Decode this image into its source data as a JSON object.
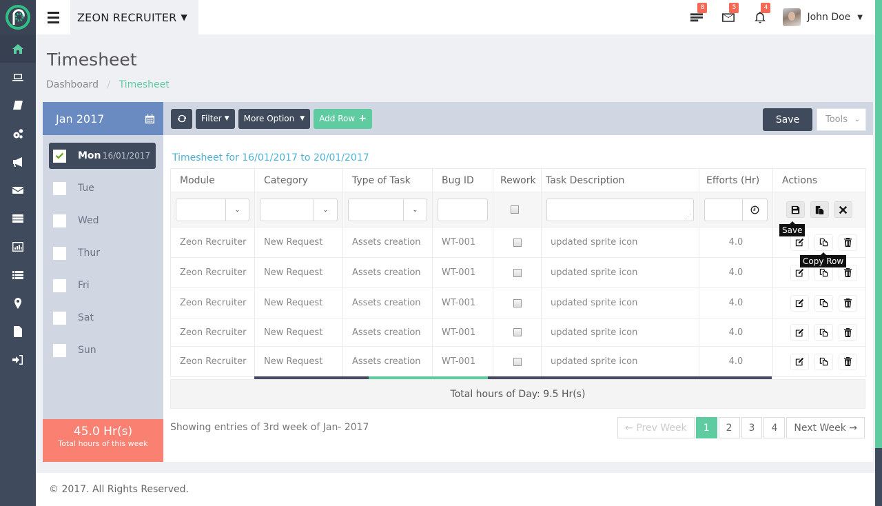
{
  "app": {
    "brand": "ZEON RECRUITER",
    "brand_caret": "▼"
  },
  "sidebar": {
    "items": [
      {
        "icon": "home-icon",
        "active": true
      },
      {
        "icon": "laptop-icon"
      },
      {
        "icon": "book-icon"
      },
      {
        "icon": "gears-icon"
      },
      {
        "icon": "megaphone-icon"
      },
      {
        "icon": "envelope-icon"
      },
      {
        "icon": "server-icon"
      },
      {
        "icon": "bar-chart-icon"
      },
      {
        "icon": "list-icon"
      },
      {
        "icon": "map-marker-icon"
      },
      {
        "icon": "file-icon"
      },
      {
        "icon": "sign-in-icon"
      }
    ]
  },
  "header": {
    "notifications": [
      {
        "icon": "tasks-icon",
        "count": "8"
      },
      {
        "icon": "envelope-icon",
        "count": "5"
      },
      {
        "icon": "bell-icon",
        "count": "4"
      }
    ],
    "user_name": "John Doe",
    "user_caret": "▾"
  },
  "page": {
    "title": "Timesheet",
    "breadcrumb": [
      {
        "label": "Dashboard"
      },
      {
        "label": "Timesheet",
        "current": true
      }
    ],
    "breadcrumb_sep": "/"
  },
  "days_panel": {
    "month": "Jan 2017",
    "days": [
      {
        "name": "Mon",
        "date": "16/01/2017",
        "checked": true,
        "active": true
      },
      {
        "name": "Tue",
        "checked": false
      },
      {
        "name": "Wed",
        "checked": false
      },
      {
        "name": "Thur",
        "checked": false
      },
      {
        "name": "Fri",
        "checked": false
      },
      {
        "name": "Sat",
        "checked": false
      },
      {
        "name": "Sun",
        "checked": false
      }
    ],
    "week_total_value": "45.0 Hr(s)",
    "week_total_label": "Total hours of this week"
  },
  "toolbar": {
    "filter_label": "Filter",
    "more_option_label": "More Option",
    "add_row_label": "Add Row",
    "add_row_icon": "+",
    "save_label": "Save",
    "tools_label": "Tools",
    "caret": "▾",
    "chev": "⌄"
  },
  "timesheet": {
    "range_label": "Timesheet for 16/01/2017 to 20/01/2017",
    "columns": [
      "Module",
      "Category",
      "Type of Task",
      "Bug ID",
      "Rework",
      "Task Description",
      "Efforts (Hr)",
      "Actions"
    ],
    "entry_row": {
      "module": "",
      "category": "",
      "type_of_task": "",
      "bug_id": "",
      "rework": false,
      "task_description": "",
      "efforts": ""
    },
    "rows": [
      {
        "module": "Zeon Recruiter",
        "category": "New Request",
        "type_of_task": "Assets creation",
        "bug_id": "WT-001",
        "rework": false,
        "task_description": "updated sprite icon",
        "efforts": "4.0"
      },
      {
        "module": "Zeon Recruiter",
        "category": "New Request",
        "type_of_task": "Assets creation",
        "bug_id": "WT-001",
        "rework": false,
        "task_description": "updated sprite icon",
        "efforts": "4.0"
      },
      {
        "module": "Zeon Recruiter",
        "category": "New Request",
        "type_of_task": "Assets creation",
        "bug_id": "WT-001",
        "rework": false,
        "task_description": "updated sprite icon",
        "efforts": "4.0"
      },
      {
        "module": "Zeon Recruiter",
        "category": "New Request",
        "type_of_task": "Assets creation",
        "bug_id": "WT-001",
        "rework": false,
        "task_description": "updated sprite icon",
        "efforts": "4.0"
      },
      {
        "module": "Zeon Recruiter",
        "category": "New Request",
        "type_of_task": "Assets creation",
        "bug_id": "WT-001",
        "rework": false,
        "task_description": "updated sprite icon",
        "efforts": "4.0"
      }
    ],
    "tooltips": {
      "save": "Save",
      "copy_row": "Copy Row"
    },
    "day_total": "Total hours of Day: 9.5 Hr(s)"
  },
  "pagination": {
    "showing": "Showing entries of 3rd week of Jan- 2017",
    "prev": "← Prev Week",
    "pages": [
      "1",
      "2",
      "3",
      "4"
    ],
    "active_page": "1",
    "next": "Next Week →"
  },
  "footer": {
    "copyright": "© 2017. All Rights Reserved."
  },
  "colors": {
    "accent": "#5ecba1",
    "sidebar": "#3f4a5c",
    "month_header": "#6a8bc1",
    "week_total": "#fa8072",
    "badge": "#f56954",
    "link": "#4ab2d6"
  }
}
